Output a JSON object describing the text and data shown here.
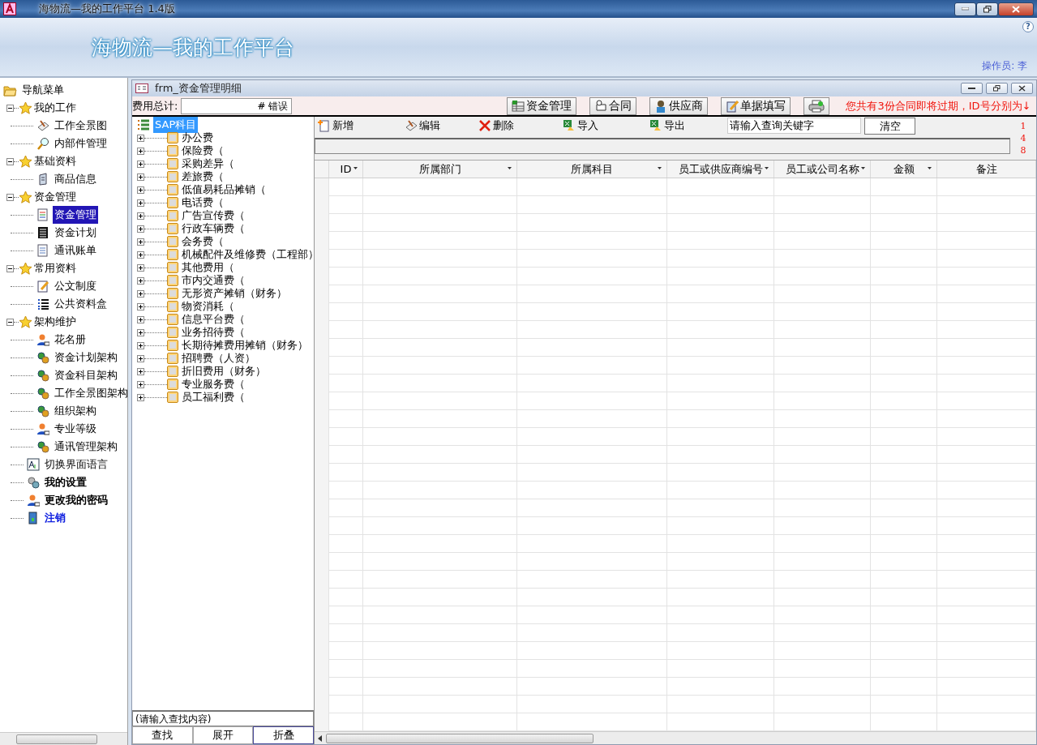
{
  "window": {
    "title": "海物流—我的工作平台 1.4版"
  },
  "header": {
    "title": "海物流—我的工作平台",
    "help": "?",
    "operator": "操作员: 李"
  },
  "nav": {
    "root": {
      "label": "导航菜单"
    },
    "items": [
      {
        "label": "我的工作",
        "expanded": true,
        "selected": false,
        "children": [
          {
            "label": "工作全景图",
            "selected": false
          },
          {
            "label": "内部件管理",
            "selected": false
          }
        ]
      },
      {
        "label": "基础资料",
        "expanded": true,
        "selected": false,
        "children": [
          {
            "label": "商品信息",
            "selected": false
          }
        ]
      },
      {
        "label": "资金管理",
        "expanded": true,
        "selected": false,
        "children": [
          {
            "label": "资金管理",
            "selected": true
          },
          {
            "label": "资金计划",
            "selected": false
          },
          {
            "label": "通讯账单",
            "selected": false
          }
        ]
      },
      {
        "label": "常用资料",
        "expanded": true,
        "selected": false,
        "children": [
          {
            "label": "公文制度",
            "selected": false
          },
          {
            "label": "公共资料盒",
            "selected": false
          }
        ]
      },
      {
        "label": "架构维护",
        "expanded": true,
        "selected": false,
        "children": [
          {
            "label": "花名册",
            "selected": false
          },
          {
            "label": "资金计划架构",
            "selected": false
          },
          {
            "label": "资金科目架构",
            "selected": false
          },
          {
            "label": "工作全景图架构",
            "selected": false
          },
          {
            "label": "组织架构",
            "selected": false
          },
          {
            "label": "专业等级",
            "selected": false
          },
          {
            "label": "通讯管理架构",
            "selected": false
          }
        ]
      },
      {
        "label": "切换界面语言",
        "selected": false,
        "kind": "plain"
      },
      {
        "label": "我的设置",
        "selected": false,
        "kind": "strong"
      },
      {
        "label": "更改我的密码",
        "selected": false,
        "kind": "strong"
      },
      {
        "label": "注销",
        "selected": false,
        "kind": "link"
      }
    ]
  },
  "form": {
    "title": "frm_资金管理明细",
    "total_label": "费用总计:",
    "total_value": "# 错误",
    "buttons": [
      "资金管理",
      "合同",
      "供应商",
      "单据填写"
    ],
    "notice": "您共有3份合同即将过期，ID号分别为↓",
    "expiring_ids": [
      "1",
      "4",
      "8"
    ]
  },
  "tree": {
    "root": {
      "label": "SAP科目",
      "selected": true
    },
    "items": [
      {
        "label": "办公费",
        "expanded": false
      },
      {
        "label": "保险费（",
        "expanded": false
      },
      {
        "label": "采购差异（",
        "expanded": false
      },
      {
        "label": "差旅费（",
        "expanded": false
      },
      {
        "label": "低值易耗品摊销（",
        "expanded": false
      },
      {
        "label": "电话费（",
        "expanded": false
      },
      {
        "label": "广告宣传费（",
        "expanded": false
      },
      {
        "label": "行政车辆费（",
        "expanded": false
      },
      {
        "label": "会务费（",
        "expanded": false
      },
      {
        "label": "机械配件及维修费（工程部）",
        "expanded": false
      },
      {
        "label": "其他费用（",
        "expanded": false
      },
      {
        "label": "市内交通费（",
        "expanded": false
      },
      {
        "label": "无形资产摊销（财务）",
        "expanded": false
      },
      {
        "label": "物资消耗（",
        "expanded": false
      },
      {
        "label": "信息平台费（",
        "expanded": false
      },
      {
        "label": "业务招待费（",
        "expanded": false
      },
      {
        "label": "长期待摊费用摊销（财务）",
        "expanded": false
      },
      {
        "label": "招聘费（人资）",
        "expanded": false
      },
      {
        "label": "折旧费用（财务）",
        "expanded": false
      },
      {
        "label": "专业服务费（",
        "expanded": false
      },
      {
        "label": "员工福利费（",
        "expanded": false
      }
    ],
    "search_value": "(请输入查找内容)",
    "buttons": [
      {
        "label": "查找",
        "focused": false
      },
      {
        "label": "展开",
        "focused": false
      },
      {
        "label": "折叠",
        "focused": true
      }
    ]
  },
  "toolbar": {
    "buttons": [
      "新增",
      "编辑",
      "删除",
      "导入",
      "导出"
    ],
    "search_value": "请输入查询关键字",
    "clear": "清空"
  },
  "table": {
    "columns": [
      "ID",
      "所属部门",
      "所属科目",
      "员工或供应商编号",
      "员工或公司名称",
      "金额",
      "备注"
    ]
  }
}
